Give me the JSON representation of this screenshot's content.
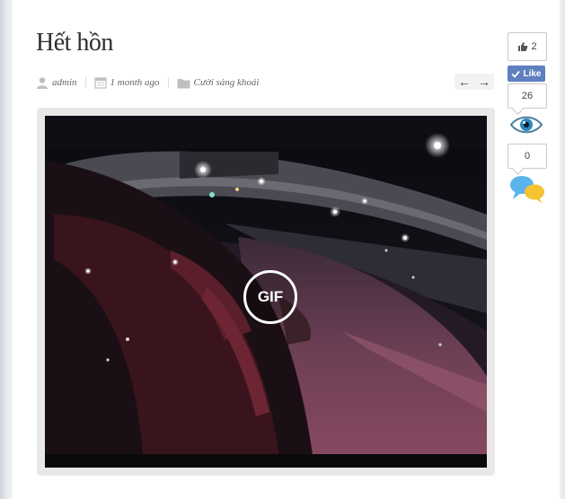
{
  "post": {
    "title": "Hết hồn",
    "author": "admin",
    "date": "1 month ago",
    "category": "Cười sảng khoái"
  },
  "pager": {
    "prev": "←",
    "next": "→"
  },
  "media": {
    "badge": "GIF"
  },
  "social": {
    "likes": "2",
    "like_label": "Like",
    "views": "26",
    "comments": "0"
  }
}
